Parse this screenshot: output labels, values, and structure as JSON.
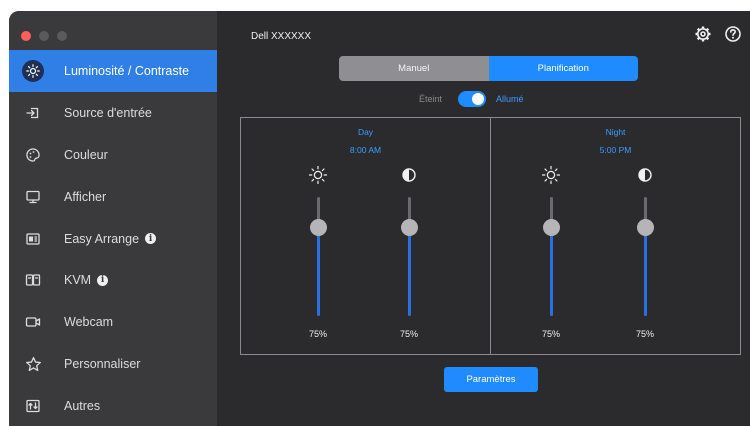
{
  "device": {
    "name": "Dell XXXXXX"
  },
  "sidebar": {
    "items": [
      {
        "label": "Luminosité / Contraste",
        "icon": "brightness-icon",
        "active": true,
        "info": false
      },
      {
        "label": "Source d'entrée",
        "icon": "input-source-icon",
        "active": false,
        "info": false
      },
      {
        "label": "Couleur",
        "icon": "palette-icon",
        "active": false,
        "info": false
      },
      {
        "label": "Afficher",
        "icon": "monitor-icon",
        "active": false,
        "info": false
      },
      {
        "label": "Easy Arrange",
        "icon": "easy-arrange-icon",
        "active": false,
        "info": true
      },
      {
        "label": "KVM",
        "icon": "kvm-icon",
        "active": false,
        "info": true
      },
      {
        "label": "Webcam",
        "icon": "webcam-icon",
        "active": false,
        "info": false
      },
      {
        "label": "Personnaliser",
        "icon": "star-icon",
        "active": false,
        "info": false
      },
      {
        "label": "Autres",
        "icon": "others-icon",
        "active": false,
        "info": false
      }
    ]
  },
  "tabs": {
    "manual": "Manuel",
    "schedule": "Planification",
    "selected": "schedule"
  },
  "toggle": {
    "off_label": "Éteint",
    "on_label": "Allumé",
    "state": "on"
  },
  "panels": {
    "day": {
      "title": "Day",
      "time": "8:00 AM",
      "brightness": 75,
      "contrast": 75,
      "brightness_label": "75%",
      "contrast_label": "75%"
    },
    "night": {
      "title": "Night",
      "time": "5:00 PM",
      "brightness": 75,
      "contrast": 75,
      "brightness_label": "75%",
      "contrast_label": "75%"
    }
  },
  "buttons": {
    "settings": "Paramètres"
  },
  "colors": {
    "accent": "#1f8bff",
    "sidebar_active": "#2f7fe6",
    "window_bg": "#2b2b2d",
    "sidebar_bg": "#3a3a3c"
  }
}
